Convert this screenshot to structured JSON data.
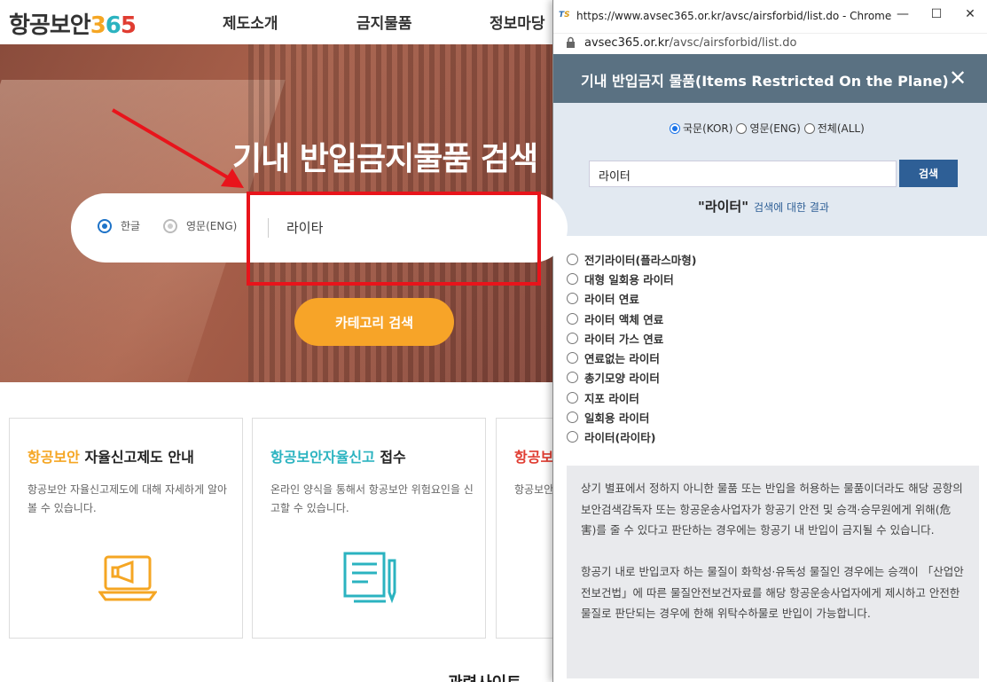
{
  "site": {
    "logo_text": "항공보안",
    "logo_number": {
      "d1": "3",
      "d2": "6",
      "d3": "5"
    },
    "nav": [
      "제도소개",
      "금지물품",
      "정보마당"
    ],
    "hero": {
      "title": "기내 반입금지물품 검색",
      "radio_kor": "한글",
      "radio_eng": "영문(ENG)",
      "query": "라이타",
      "category_button": "카테고리 검색"
    },
    "cards": [
      {
        "accent": "항공보안",
        "title": " 자율신고제도 안내",
        "desc": "항공보안 자율신고제도에 대해 자세하게 알아볼 수 있습니다."
      },
      {
        "accent": "항공보안자율신고",
        "title": " 접수",
        "desc": "온라인 양식을 통해서 항공보안 위험요인을 신고할 수 있습니다."
      },
      {
        "accent": "항공보",
        "title": "",
        "desc": "항공보안 동영상을"
      }
    ],
    "related_peek": "관련사이트"
  },
  "browser": {
    "window_title": "https://www.avsec365.or.kr/avsc/airsforbid/list.do - Chrome",
    "address_domain": "avsec365.or.kr",
    "address_path": "/avsc/airsforbid/list.do",
    "minimize": "—",
    "maximize": "☐",
    "close": "✕"
  },
  "popup": {
    "title": "기내 반입금지 물품(Items Restricted On the Plane)",
    "close_glyph": "✕",
    "lang_options": [
      "국문(KOR)",
      "영문(ENG)",
      "전체(ALL)"
    ],
    "selected_lang": "국문(KOR)",
    "search_value": "라이터",
    "search_button": "검색",
    "result_term": "\"라이터\"",
    "result_suffix": "검색에 대한 결과",
    "results": [
      "전기라이터(플라스마형)",
      "대형 일회용 라이터",
      "라이터 연료",
      "라이터 액체 연료",
      "라이터 가스 연료",
      "연료없는 라이터",
      "총기모양 라이터",
      "지포 라이터",
      "일회용 라이터",
      "라이터(라이타)"
    ],
    "notice_1": "상기 별표에서 정하지 아니한 물품 또는 반입을 허용하는 물품이더라도 해당 공항의 보안검색감독자 또는 항공운송사업자가 항공기 안전 및 승객·승무원에게 위해(危害)를 줄 수 있다고 판단하는 경우에는 항공기 내 반입이 금지될 수 있습니다.",
    "notice_2": "항공기 내로 반입코자 하는 물질이 화학성·유독성 물질인 경우에는 승객이 「산업안전보건법」에 따른 물질안전보건자료를 해당 항공운송사업자에게 제시하고 안전한 물질로 판단되는 경우에 한해 위탁수하물로 반입이 가능합니다."
  },
  "colors": {
    "popup_header": "#5a7182",
    "search_panel": "#e2e9f1",
    "search_button": "#2e5f96",
    "category_button": "#f7a428",
    "annotation_red": "#e8141b"
  }
}
